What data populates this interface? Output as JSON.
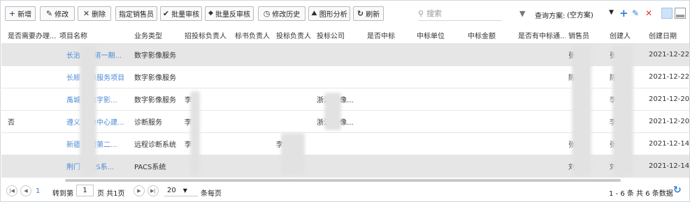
{
  "toolbar": {
    "buttons": [
      {
        "icon": "+",
        "label": "新增"
      },
      {
        "icon": "✎",
        "label": "修改"
      },
      {
        "icon": "✕",
        "label": "删除"
      },
      {
        "icon": "",
        "label": "指定销售员"
      },
      {
        "icon": "✔",
        "label": "批量审核"
      },
      {
        "icon": "◆",
        "label": "批量反审核"
      },
      {
        "icon": "◷",
        "label": "修改历史"
      },
      {
        "icon": "⛰",
        "label": "图形分析"
      },
      {
        "icon": "↻",
        "label": "刷新"
      }
    ],
    "search_placeholder": "搜索",
    "scheme_label": "查询方案:",
    "scheme_value": "(空方案)",
    "colors": {
      "add": "#2f7fd6",
      "edit": "#2f7fd6",
      "delete": "#e03a3a"
    }
  },
  "table": {
    "columns": [
      "是否需要办理...",
      "项目名称",
      "业务类型",
      "招投标负责人",
      "标书负责人",
      "投标负责人",
      "投标公司",
      "是否中标",
      "中标单位",
      "中标金额",
      "是否有中标通...",
      "销售员",
      "创建人",
      "创建日期"
    ],
    "rows": [
      {
        "need": "",
        "project": "长治 . 疗第一期...",
        "biz": "数字影像服务",
        "zb": "",
        "bs": "",
        "tb": "",
        "company": "",
        "win": "",
        "unit": "",
        "amount": "",
        "notice": "",
        "sales": "张",
        "creator": "张",
        "date": "2021-12-22"
      },
      {
        "need": "",
        "project": "长顺 修像服务项目",
        "biz": "数字影像服务",
        "zb": "",
        "bs": "",
        "tb": "",
        "company": "",
        "win": "",
        "unit": "",
        "amount": "",
        "notice": "",
        "sales": "陈",
        "creator": "陈",
        "date": "2021-12-22"
      },
      {
        "need": "",
        "project": "禹城 院数字影...",
        "biz": "数字影像服务",
        "zb": "李",
        "bs": "",
        "tb": "",
        "company": "浙江 影像...",
        "win": "",
        "unit": "",
        "amount": "",
        "notice": "",
        "sales": "",
        "creator": "李",
        "date": "2021-12-20"
      },
      {
        "need": "否",
        "project": "遵义 修像中心建...",
        "biz": "诊断服务",
        "zb": "李",
        "bs": "",
        "tb": "",
        "company": "浙江 影像...",
        "win": "",
        "unit": "",
        "amount": "",
        "notice": "",
        "sales": "",
        "creator": "李",
        "date": "2021-12-20"
      },
      {
        "need": "",
        "project": "新疆 兵团第二...",
        "biz": "远程诊断系统",
        "zb": "李",
        "bs": "",
        "tb": "李",
        "company": "",
        "win": "",
        "unit": "",
        "amount": "",
        "notice": "",
        "sales": "张",
        "creator": "张",
        "date": "2021-12-14"
      },
      {
        "need": "",
        "project": "荆门 PACS系...",
        "biz": "PACS系统",
        "zb": "",
        "bs": "",
        "tb": "",
        "company": "",
        "win": "",
        "unit": "",
        "amount": "",
        "notice": "",
        "sales": "刘",
        "creator": "刘",
        "date": "2021-12-14"
      }
    ]
  },
  "pager": {
    "goto_label": "转到第",
    "page_value": "1",
    "page_suffix": "页 共1页",
    "page_size": "20",
    "per_page_label": "条每页",
    "summary": "1 - 6 条  共 6 条数据"
  }
}
